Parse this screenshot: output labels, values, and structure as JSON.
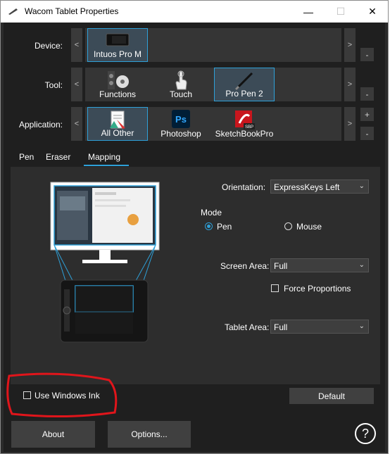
{
  "window": {
    "title": "Wacom Tablet Properties"
  },
  "titlebar": {
    "minimize": "—",
    "maximize": "☐",
    "close": "✕"
  },
  "labels": {
    "device": "Device:",
    "tool": "Tool:",
    "application": "Application:"
  },
  "devices": [
    {
      "label": "Intuos Pro M",
      "icon": "tablet-icon",
      "selected": true
    }
  ],
  "tools": [
    {
      "label": "Functions",
      "icon": "functions-icon",
      "selected": false
    },
    {
      "label": "Touch",
      "icon": "touch-hand-icon",
      "selected": false
    },
    {
      "label": "Pro Pen 2",
      "icon": "pen-icon",
      "selected": true
    }
  ],
  "applications": [
    {
      "label": "All Other",
      "icon": "all-other-apps-icon",
      "selected": true
    },
    {
      "label": "Photoshop",
      "icon": "photoshop-icon",
      "selected": false,
      "icon_text": "Ps"
    },
    {
      "label": "SketchBookPro",
      "icon": "sketchbookpro-icon",
      "selected": false,
      "icon_text": "SBP"
    }
  ],
  "nav": {
    "left": "<",
    "right": ">",
    "add": "+",
    "remove": "-"
  },
  "tabs": [
    {
      "label": "Pen"
    },
    {
      "label": "Eraser"
    },
    {
      "label": "Mapping",
      "active": true
    }
  ],
  "mapping": {
    "orientation_label": "Orientation:",
    "orientation_value": "ExpressKeys Left",
    "mode_label": "Mode",
    "mode_pen": "Pen",
    "mode_mouse": "Mouse",
    "mode_selected": "Pen",
    "screen_area_label": "Screen Area:",
    "screen_area_value": "Full",
    "force_proportions_label": "Force Proportions",
    "force_proportions_checked": false,
    "tablet_area_label": "Tablet Area:",
    "tablet_area_value": "Full"
  },
  "use_windows_ink": {
    "label": "Use Windows Ink",
    "checked": false
  },
  "buttons": {
    "default": "Default",
    "about": "About",
    "options": "Options...",
    "help": "?"
  },
  "colors": {
    "accent": "#2ea0d8",
    "annotation": "#e0151b"
  }
}
